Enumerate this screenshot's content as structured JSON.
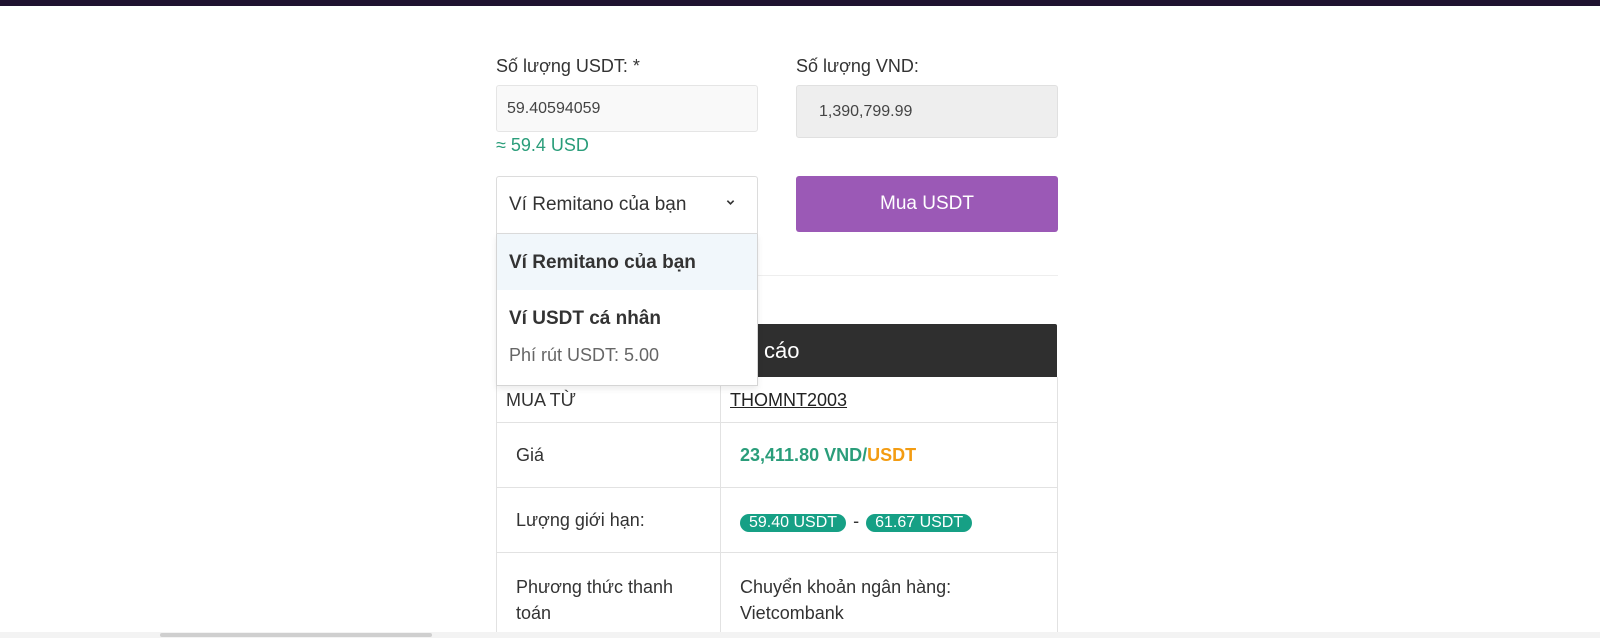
{
  "form": {
    "usdt_label": "Số lượng USDT: *",
    "usdt_value": "59.40594059",
    "usd_approx": "≈ 59.4 USD",
    "vnd_label": "Số lượng VND:",
    "vnd_value": "1,390,799.99",
    "wallet_selected": "Ví Remitano của bạn",
    "buy_button": "Mua USDT"
  },
  "dropdown": {
    "options": [
      {
        "title": "Ví Remitano của bạn"
      },
      {
        "title": "Ví USDT cá nhân",
        "subtitle": "Phí rút USDT: 5.00"
      }
    ]
  },
  "ad": {
    "header_visible": "cáo",
    "rows": {
      "buy_from_label": "MUA TỪ",
      "buy_from_value": "THOMNT2003",
      "price_label": "Giá",
      "price_amount": "23,411.80 VND/",
      "price_currency": "USDT",
      "limit_label": "Lượng giới hạn:",
      "limit_min": "59.40 USDT",
      "limit_sep": "-",
      "limit_max": "61.67 USDT",
      "payment_label": "Phương thức thanh toán",
      "payment_value": "Chuyển khoản ngân hàng: Vietcombank"
    }
  },
  "colors": {
    "accent_purple": "#9b59b6",
    "green": "#2a9d7a",
    "orange": "#f39c12",
    "pill_green": "#16a085"
  },
  "icons": {
    "select_chevron": "chevron-down-icon"
  }
}
